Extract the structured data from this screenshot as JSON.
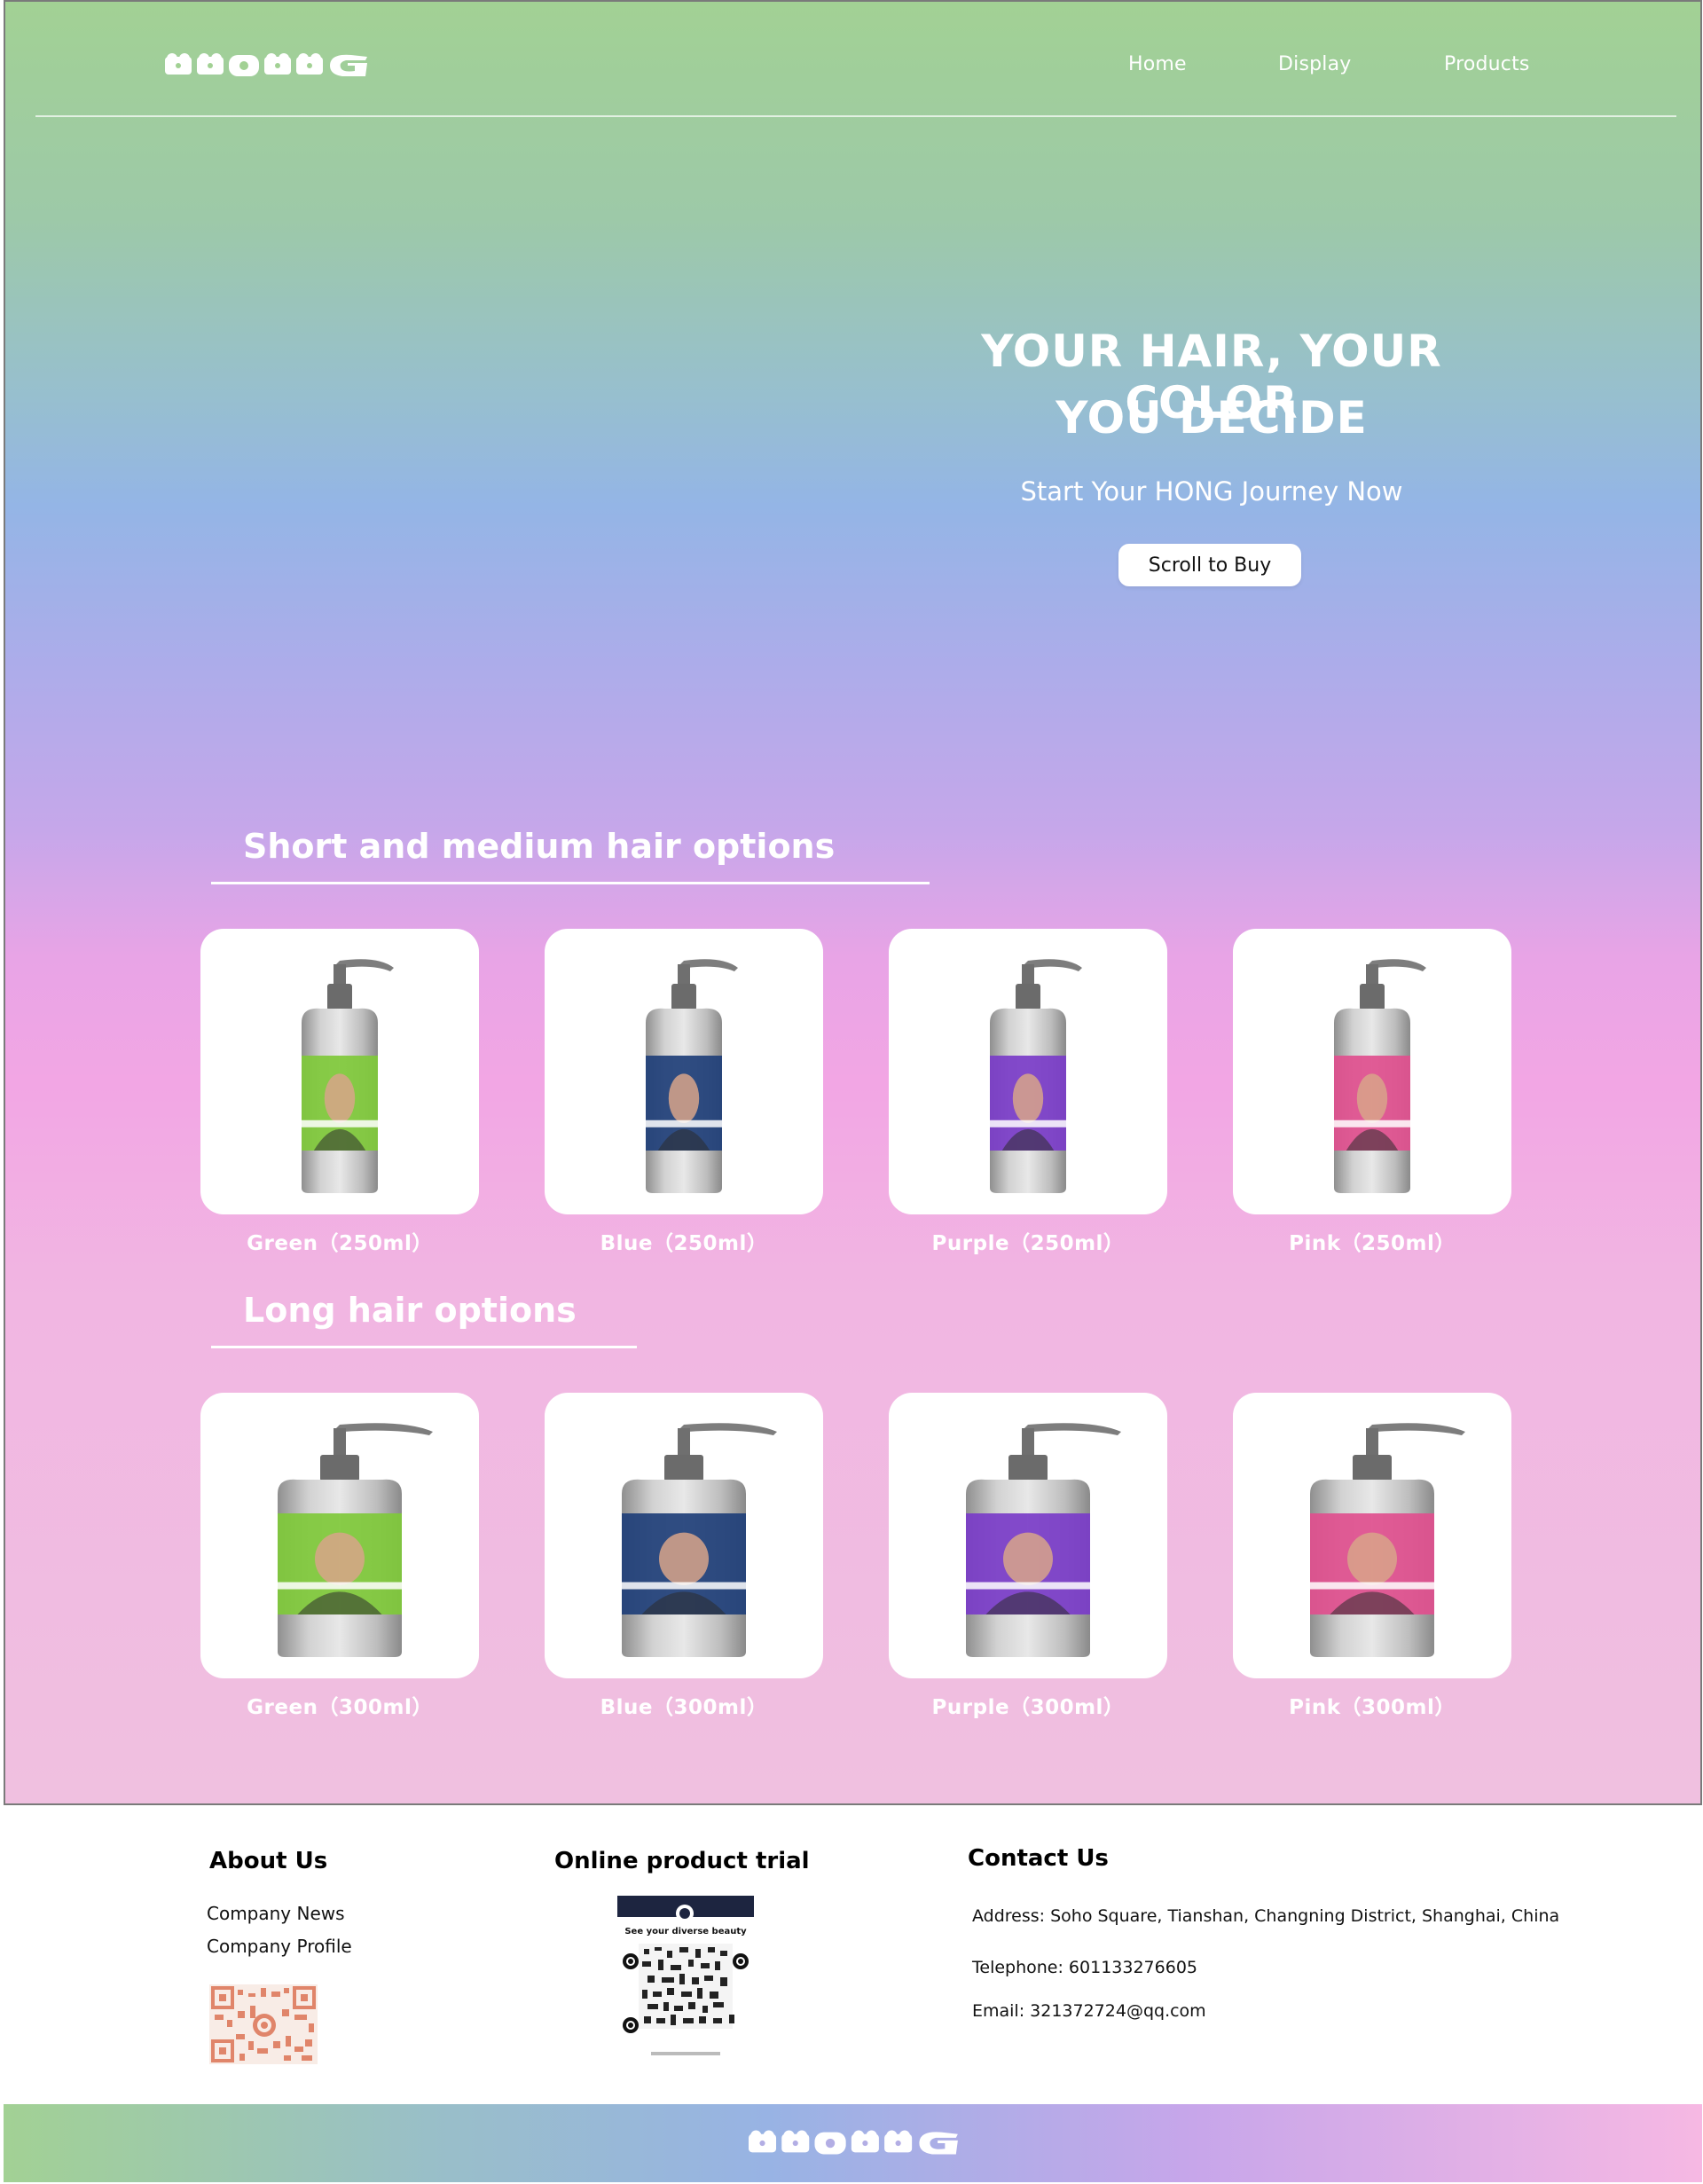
{
  "brand": {
    "name": "HONG",
    "logo_icon": "hong-stylized-logo"
  },
  "nav": {
    "home": "Home",
    "display": "Display",
    "products": "Products"
  },
  "hero": {
    "title_line1": "YOUR HAIR, YOUR COLOR",
    "title_line2": "YOU DECIDE",
    "subtitle": "Start Your HONG Journey Now",
    "button_label": "Scroll to Buy"
  },
  "short_section": {
    "title": "Short and medium hair options",
    "products": [
      {
        "label": "Green（250ml）",
        "color": "#7fc93a"
      },
      {
        "label": "Blue（250ml）",
        "color": "#1f3f78"
      },
      {
        "label": "Purple（250ml）",
        "color": "#7a3cc8"
      },
      {
        "label": "Pink（250ml）",
        "color": "#e04f8e"
      }
    ]
  },
  "long_section": {
    "title": "Long hair options",
    "products": [
      {
        "label": "Green（300ml）",
        "color": "#7fc93a"
      },
      {
        "label": "Blue（300ml）",
        "color": "#1f3f78"
      },
      {
        "label": "Purple（300ml）",
        "color": "#7a3cc8"
      },
      {
        "label": "Pink（300ml）",
        "color": "#e04f8e"
      }
    ]
  },
  "footer": {
    "about": {
      "heading": "About Us",
      "links": [
        "Company News",
        "Company Profile"
      ],
      "qr_icon": "wechat-qr-code-icon"
    },
    "trial": {
      "heading": "Online product trial",
      "qr_caption": "See your diverse beauty",
      "qr_icon": "douyin-qr-code-icon"
    },
    "contact": {
      "heading": "Contact Us",
      "address": "Address: Soho Square, Tianshan, Changning District, Shanghai, China",
      "telephone": "Telephone: 601133276605",
      "email": "Email: 321372724@qq.com"
    }
  },
  "colors": {
    "gradient_top": "#a2d194",
    "gradient_mid_blue": "#94b5e6",
    "gradient_mid_pink": "#f2a6e4",
    "gradient_bottom": "#f0c0e0",
    "wechat_qr": "#e0856a"
  }
}
